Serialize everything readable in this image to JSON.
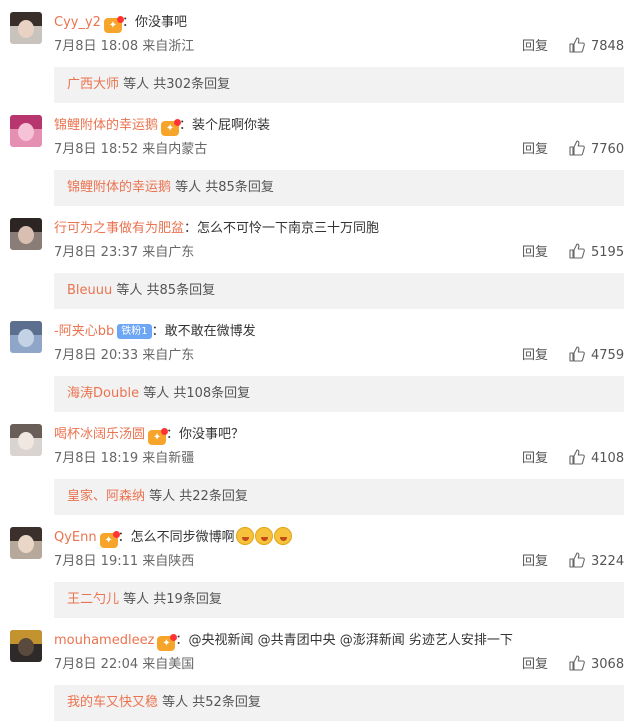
{
  "ui": {
    "reply_label": "回复"
  },
  "comments": [
    {
      "user": "Cyy_y2",
      "badge": "✦",
      "fan_badge": null,
      "text_parts": [
        "你没事吧"
      ],
      "date": "7月8日 18:08",
      "location": "来自浙江",
      "likes": "7848",
      "sub_user": "广西大师",
      "sub_suffix": "等人 共302条回复",
      "avatar": {
        "bg": "#c9c3bd",
        "hair": "#3a2e2a",
        "face": "#e9d2c3"
      }
    },
    {
      "user": "锦鲤附体的幸运鹅",
      "badge": "✦",
      "fan_badge": null,
      "text_parts": [
        "装个屁啊你装"
      ],
      "date": "7月8日 18:52",
      "location": "来自内蒙古",
      "likes": "7760",
      "sub_user": "锦鲤附体的幸运鹅",
      "sub_suffix": "等人 共85条回复",
      "avatar": {
        "bg": "#e58fb3",
        "hair": "#b8366e",
        "face": "#f6c2d6"
      }
    },
    {
      "user": "行可为之事做有为肥盆",
      "badge": null,
      "fan_badge": null,
      "text_parts": [
        "怎么不可怜一下南京三十万同胞"
      ],
      "date": "7月8日 23:37",
      "location": "来自广东",
      "likes": "5195",
      "sub_user": "Bleuuu",
      "sub_suffix": "等人 共85条回复",
      "avatar": {
        "bg": "#8a7d78",
        "hair": "#2d2523",
        "face": "#d9bfb1"
      }
    },
    {
      "user": "-阿夹心bb",
      "badge": null,
      "fan_badge": "铁粉1",
      "text_parts": [
        "敢不敢在微博发"
      ],
      "date": "7月8日 20:33",
      "location": "来自广东",
      "likes": "4759",
      "sub_user": "海涛Double",
      "sub_suffix": "等人 共108条回复",
      "avatar": {
        "bg": "#8fa6c9",
        "hair": "#5c6f8f",
        "face": "#c4d2e6"
      }
    },
    {
      "user": "喝杯冰阔乐汤圆",
      "badge": "✦",
      "fan_badge": null,
      "text_parts": [
        "你没事吧？"
      ],
      "date": "7月8日 18:19",
      "location": "来自新疆",
      "likes": "4108",
      "sub_user": "皇家、阿森纳",
      "sub_suffix": "等人 共22条回复",
      "avatar": {
        "bg": "#d9d4cf",
        "hair": "#6a5f58",
        "face": "#efe7e0"
      }
    },
    {
      "user": "QyEnn",
      "badge": "✦",
      "fan_badge": null,
      "text_parts": [
        "怎么不同步微博啊"
      ],
      "emoji_count": 3,
      "date": "7月8日 19:11",
      "location": "来自陕西",
      "likes": "3224",
      "sub_user": "王二勺儿",
      "sub_suffix": "等人 共19条回复",
      "avatar": {
        "bg": "#b7a89c",
        "hair": "#3b302b",
        "face": "#ead6c6"
      }
    },
    {
      "user": "mouhamedleez",
      "badge": "✦",
      "fan_badge": null,
      "text_parts": [
        "@央视新闻 @共青团中央 @澎湃新闻 劣迹艺人安排一下"
      ],
      "date": "7月8日 22:04",
      "location": "来自美国",
      "likes": "3068",
      "sub_user": "我的车又快又稳",
      "sub_suffix": "等人 共52条回复",
      "avatar": {
        "bg": "#2e2a2a",
        "hair": "#c2932e",
        "face": "#5a4a3e"
      }
    }
  ]
}
